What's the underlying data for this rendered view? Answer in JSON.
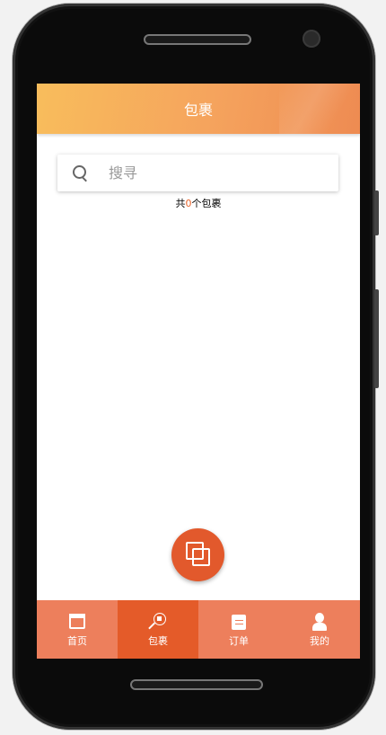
{
  "header": {
    "title": "包裹"
  },
  "search": {
    "placeholder": "搜寻",
    "value": ""
  },
  "summary": {
    "prefix": "共",
    "count": "0",
    "suffix": "个包裹"
  },
  "fab": {
    "icon": "copy-squares-icon"
  },
  "tabs": [
    {
      "label": "首页",
      "icon": "home-icon",
      "active": false
    },
    {
      "label": "包裹",
      "icon": "package-search-icon",
      "active": true
    },
    {
      "label": "订单",
      "icon": "order-scroll-icon",
      "active": false
    },
    {
      "label": "我的",
      "icon": "user-icon",
      "active": false
    }
  ],
  "colors": {
    "header_gradient_start": "#f8bd5c",
    "header_gradient_end": "#ee8b52",
    "tabbar": "#ed7f5c",
    "tab_active": "#e45b29",
    "fab": "#e2592c",
    "count_highlight": "#e8632a"
  }
}
